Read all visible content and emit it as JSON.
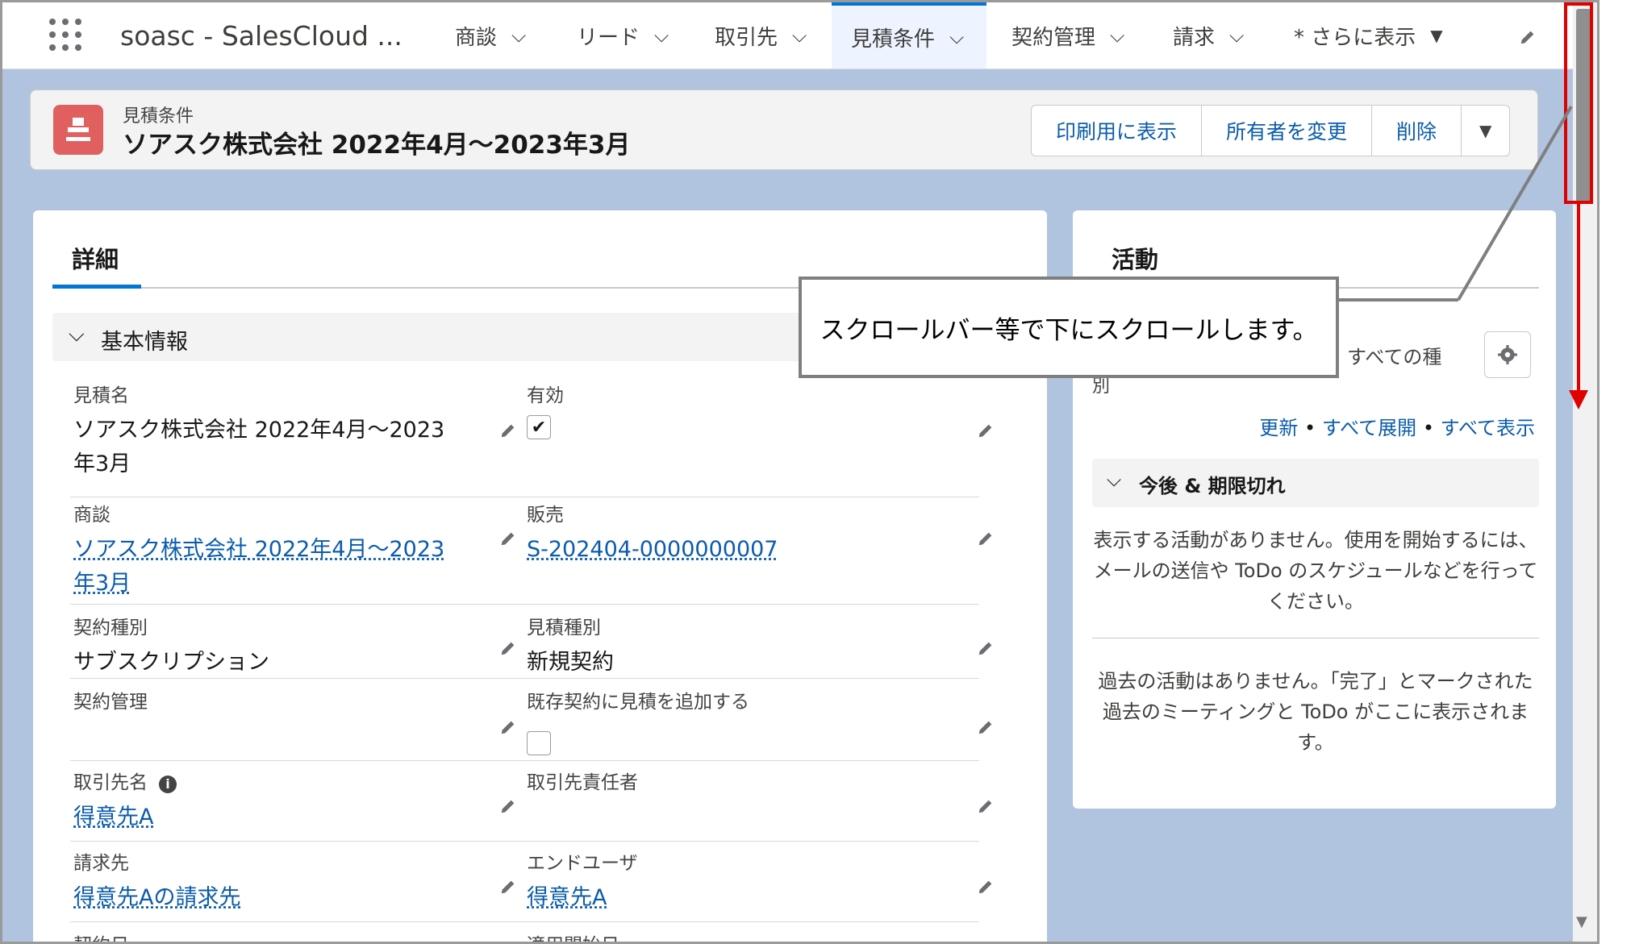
{
  "nav": {
    "app_name": "soasc - SalesCloud ...",
    "tabs": [
      {
        "label": "商談"
      },
      {
        "label": "リード"
      },
      {
        "label": "取引先"
      },
      {
        "label": "見積条件"
      },
      {
        "label": "契約管理"
      },
      {
        "label": "請求"
      },
      {
        "label": "* さらに表示"
      }
    ],
    "active_tab": "見積条件"
  },
  "header": {
    "object_label": "見積条件",
    "record_title": "ソアスク株式会社 2022年4月～2023年3月",
    "buttons": [
      "印刷用に表示",
      "所有者を変更",
      "削除"
    ]
  },
  "detail": {
    "tab_label": "詳細",
    "section_label": "基本情報",
    "fields": [
      {
        "label": "見積名",
        "value": "ソアスク株式会社 2022年4月～2023年3月",
        "type": "text"
      },
      {
        "label": "有効",
        "value": "✔",
        "type": "checkbox"
      },
      {
        "label": "商談",
        "value": "ソアスク株式会社 2022年4月～2023年3月",
        "type": "link"
      },
      {
        "label": "販売",
        "value": "S-202404-0000000007",
        "type": "link"
      },
      {
        "label": "契約種別",
        "value": "サブスクリプション",
        "type": "text"
      },
      {
        "label": "見積種別",
        "value": "新規契約",
        "type": "text"
      },
      {
        "label": "契約管理",
        "value": "",
        "type": "text"
      },
      {
        "label": "既存契約に見積を追加する",
        "value": "",
        "type": "checkbox"
      },
      {
        "label": "取引先名",
        "value": "得意先A",
        "type": "link"
      },
      {
        "label": "取引先責任者",
        "value": "",
        "type": "text"
      },
      {
        "label": "請求先",
        "value": "得意先Aの請求先",
        "type": "link"
      },
      {
        "label": "エンドユーザ",
        "value": "得意先A",
        "type": "link"
      },
      {
        "label": "契約日",
        "value": "",
        "type": "text"
      },
      {
        "label": "適用開始日",
        "value": "",
        "type": "text"
      }
    ]
  },
  "activity": {
    "title": "活動",
    "filter_text": "すべての種",
    "filter_text_2": "別",
    "links": [
      "更新",
      "すべて展開",
      "すべて表示"
    ],
    "separator": "•",
    "section_label": "今後 & 期限切れ",
    "empty_upcoming": "表示する活動がありません。使用を開始するには、メールの送信や ToDo のスケジュールなどを行ってください。",
    "empty_past": "過去の活動はありません。「完了」とマークされた過去のミーティングと ToDo がここに表示されます。"
  },
  "callout": {
    "text": "スクロールバー等で下にスクロールします。"
  },
  "colors": {
    "accent": "#0176d3",
    "link": "#0b5cab",
    "object_icon": "#e06060",
    "highlight": "#e00000"
  }
}
